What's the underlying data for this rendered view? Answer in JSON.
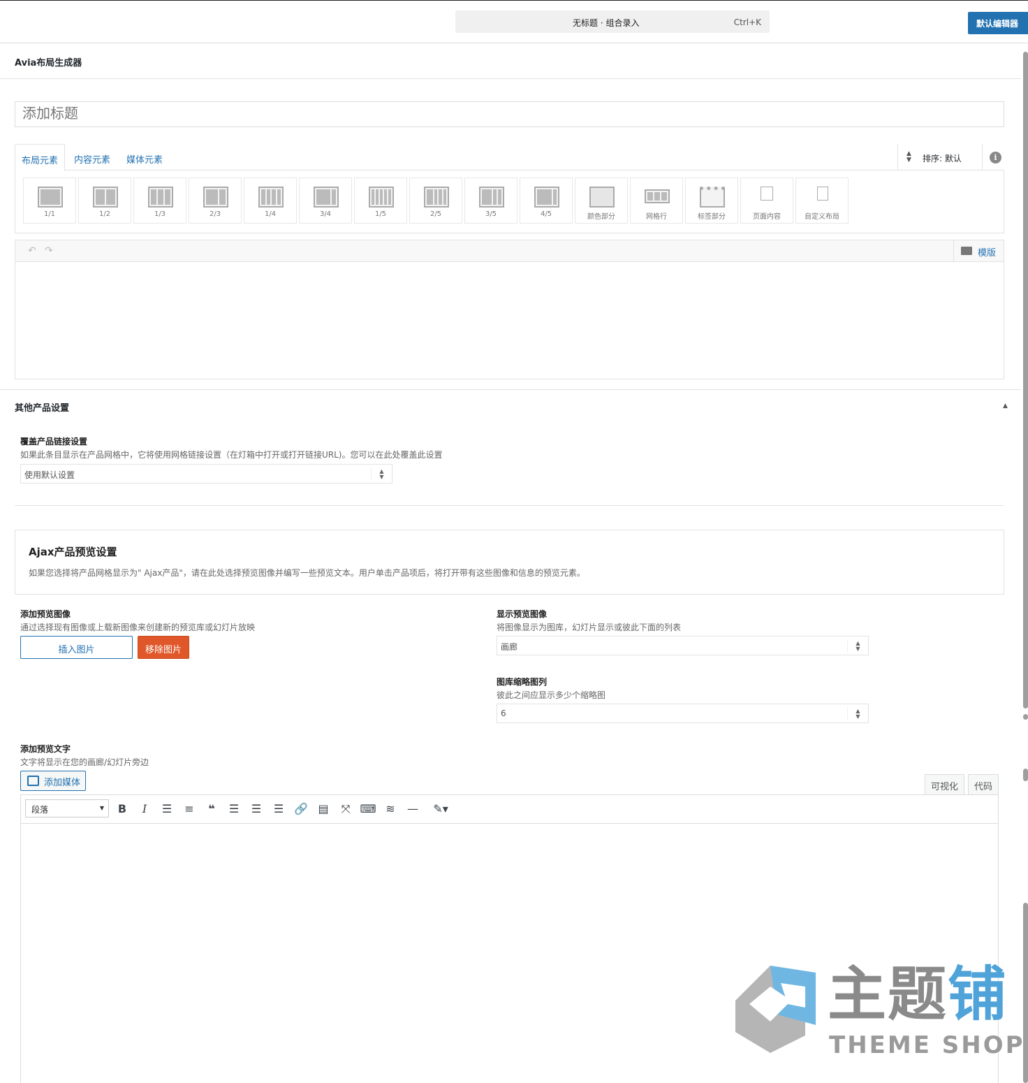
{
  "topbar": {
    "command_title": "无标题 · 组合录入",
    "command_shortcut": "Ctrl+K",
    "default_editor_button": "默认编辑器"
  },
  "builder": {
    "title": "Avia布局生成器",
    "post_title_placeholder": "添加标题",
    "tabs": [
      "布局元素",
      "内容元素",
      "媒体元素"
    ],
    "sort_label": "排序: 默认",
    "elements": [
      "1/1",
      "1/2",
      "1/3",
      "2/3",
      "1/4",
      "3/4",
      "1/5",
      "2/5",
      "3/5",
      "4/5",
      "颜色部分",
      "网格行",
      "标签部分",
      "页面内容",
      "自定义布局"
    ],
    "template_label": "模版"
  },
  "other_settings": {
    "title": "其他产品设置",
    "link_override": {
      "title": "覆盖产品链接设置",
      "desc": "如果此条目显示在产品网格中，它将使用网格链接设置（在灯箱中打开或打开链接URL)。您可以在此处覆盖此设置",
      "value": "使用默认设置"
    }
  },
  "ajax": {
    "title": "Ajax产品预览设置",
    "desc": "如果您选择将产品网格显示为\" Ajax产品\"，请在此处选择预览图像并编写一些预览文本。用户单击产品项后，将打开带有这些图像和信息的预览元素。",
    "add_image": {
      "title": "添加预览图像",
      "desc": "通过选择现有图像或上载新图像来创建新的预览库或幻灯片放映",
      "insert_button": "插入图片",
      "remove_button": "移除图片"
    },
    "display_image": {
      "title": "显示预览图像",
      "desc": "将图像显示为图库，幻灯片显示或彼此下面的列表",
      "value": "画廊"
    },
    "thumb_columns": {
      "title": "图库缩略图列",
      "desc": "彼此之间应显示多少个缩略图",
      "value": "6"
    },
    "preview_text": {
      "title": "添加预览文字",
      "desc": "文字将显示在您的画廊/幻灯片旁边",
      "add_media_button": "添加媒体",
      "tab_visual": "可视化",
      "tab_code": "代码",
      "format_value": "段落"
    }
  },
  "watermark": {
    "cn_gray": "主题",
    "cn_blue": "铺",
    "en": "THEME SHOP"
  },
  "colors": {
    "primary": "#2271b1",
    "danger": "#e0572a"
  }
}
